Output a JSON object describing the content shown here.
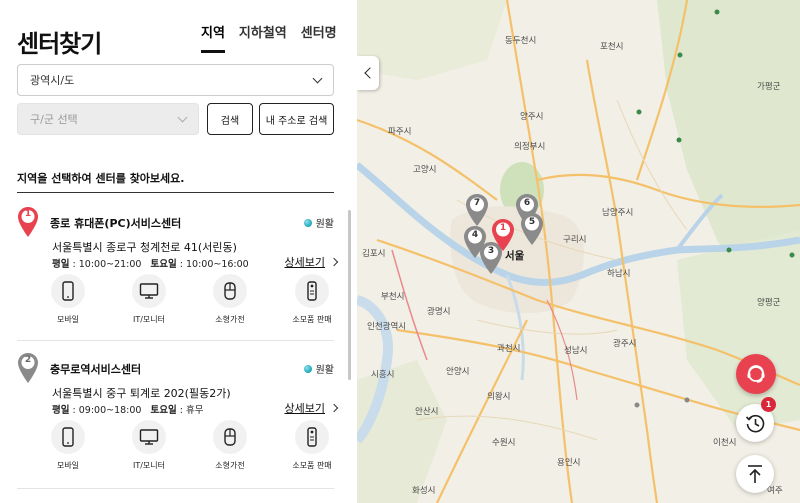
{
  "page": {
    "title": "센터찾기"
  },
  "tabs": [
    {
      "label": "지역",
      "active": true
    },
    {
      "label": "지하철역",
      "active": false
    },
    {
      "label": "센터명",
      "active": false
    }
  ],
  "filters": {
    "sido_value": "광역시/도",
    "gu_value": "구/군 선택",
    "search_label": "검색",
    "my_address_label": "내 주소로 검색"
  },
  "notice": "지역을 선택하여 센터를 찾아보세요.",
  "centers": [
    {
      "number": "1",
      "name": "종로 휴대폰(PC)서비스센터",
      "status": "원활",
      "address": "서울특별시 종로구 청계천로 41(서린동)",
      "weekday_label": "평일",
      "weekday_hours": "10:00~21:00",
      "saturday_label": "토요일",
      "saturday_hours": "10:00~16:00",
      "detail_label": "상세보기",
      "pin_color": "#e8414f",
      "services": [
        "모바일",
        "IT/모니터",
        "소형가전",
        "소모품 판매"
      ]
    },
    {
      "number": "2",
      "name": "충무로역서비스센터",
      "status": "원활",
      "address": "서울특별시 중구 퇴계로 202(필동2가)",
      "weekday_label": "평일",
      "weekday_hours": "09:00~18:00",
      "saturday_label": "토요일",
      "saturday_hours": "휴무",
      "detail_label": "상세보기",
      "pin_color": "#8a8a8a",
      "services": [
        "모바일",
        "IT/모니터",
        "소형가전",
        "소모품 판매"
      ]
    }
  ],
  "map": {
    "labels": {
      "dongducheon": "동두천시",
      "pocheon": "포천시",
      "yangju": "양주시",
      "paju": "파주시",
      "uijeongbu": "의정부시",
      "gapyeong": "가평군",
      "goyang": "고양시",
      "namyangju": "남양주시",
      "guri": "구리시",
      "seoul": "서울",
      "gimpo": "김포시",
      "hanam": "하남시",
      "bucheon": "부천시",
      "gwangmyeong": "광명시",
      "incheon": "인천광역시",
      "gwacheon": "과천시",
      "seongnam": "성남시",
      "gwangju": "광주시",
      "yangpyeong": "양평군",
      "siheung": "시흥시",
      "anyang": "안양시",
      "uiwang": "의왕시",
      "ansan": "안산시",
      "suwon": "수원시",
      "yongin": "용인시",
      "icheon": "이천시",
      "hwaseong": "화성시",
      "yeoju": "여주"
    },
    "pins": [
      "1",
      "3",
      "4",
      "5",
      "6",
      "7"
    ],
    "history_badge": "1"
  },
  "colors": {
    "accent": "#e8414f",
    "status_dot": "#1aa6b7",
    "gray_pin": "#8a8a8a"
  }
}
